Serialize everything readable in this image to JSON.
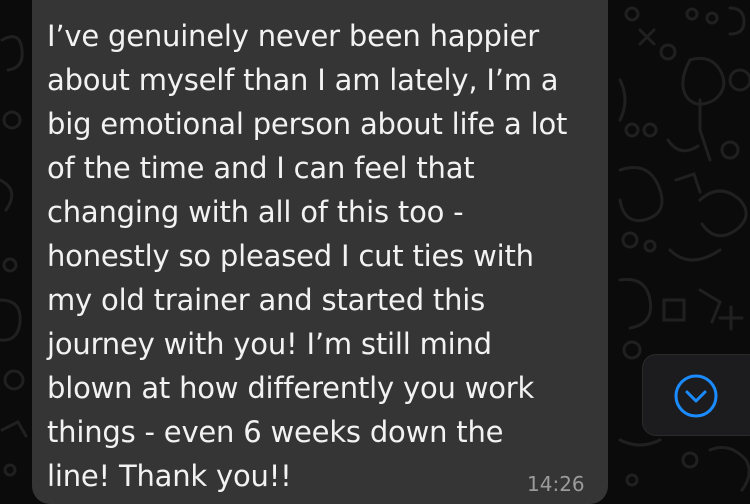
{
  "chat": {
    "message_lines": [
      "I’ve genuinely never been happier",
      "about myself than I am lately, I’m a",
      "big emotional person about life a lot",
      "of the time and I can feel that",
      "changing with all of this too -",
      "honestly so pleased I cut ties with",
      "my old trainer and started this",
      "journey with you! I’m still mind",
      "blown at how differently you work",
      "things - even 6 weeks down the",
      "line! Thank you!!"
    ],
    "timestamp": "14:26"
  },
  "controls": {
    "scroll_down_icon": "chevron-down-circle-icon"
  },
  "colors": {
    "bubble": "#353535",
    "background": "#0b0b0b",
    "accent": "#1a8cff"
  }
}
